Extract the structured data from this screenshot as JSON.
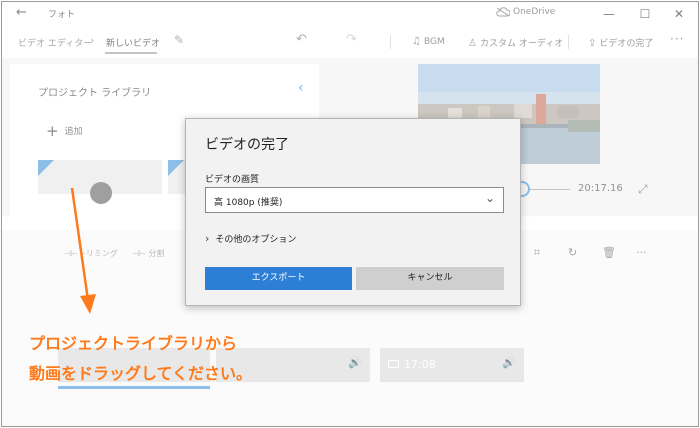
{
  "titlebar": {
    "app_title": "フォト",
    "onedrive_label": "OneDrive",
    "minimize": "—",
    "maximize": "☐",
    "close": "✕"
  },
  "toolbar": {
    "breadcrumb_root": "ビデオ エディター",
    "breadcrumb_current": "新しいビデオ",
    "bgm": "BGM",
    "custom_audio": "カスタム オーディオ",
    "finish_video": "ビデオの完了",
    "more": "···"
  },
  "library": {
    "title": "プロジェクト ライブラリ",
    "add_label": "追加"
  },
  "player": {
    "timecode": "20:17.16"
  },
  "timeline_toolbar": {
    "trimming": "トリミング",
    "split": "分割"
  },
  "storyboard": {
    "clip2_duration": "17:08"
  },
  "dialog": {
    "title": "ビデオの完了",
    "quality_label": "ビデオの画質",
    "quality_value": "高 1080p (推奨)",
    "more_options": "その他のオプション",
    "export_button": "エクスポート",
    "cancel_button": "キャンセル"
  },
  "annotation": {
    "line1": "プロジェクトライブラリから",
    "line2": "動画をドラッグしてください。"
  },
  "colors": {
    "accent_blue": "#2d7fd6",
    "annotation_orange": "#ff7a1a"
  }
}
